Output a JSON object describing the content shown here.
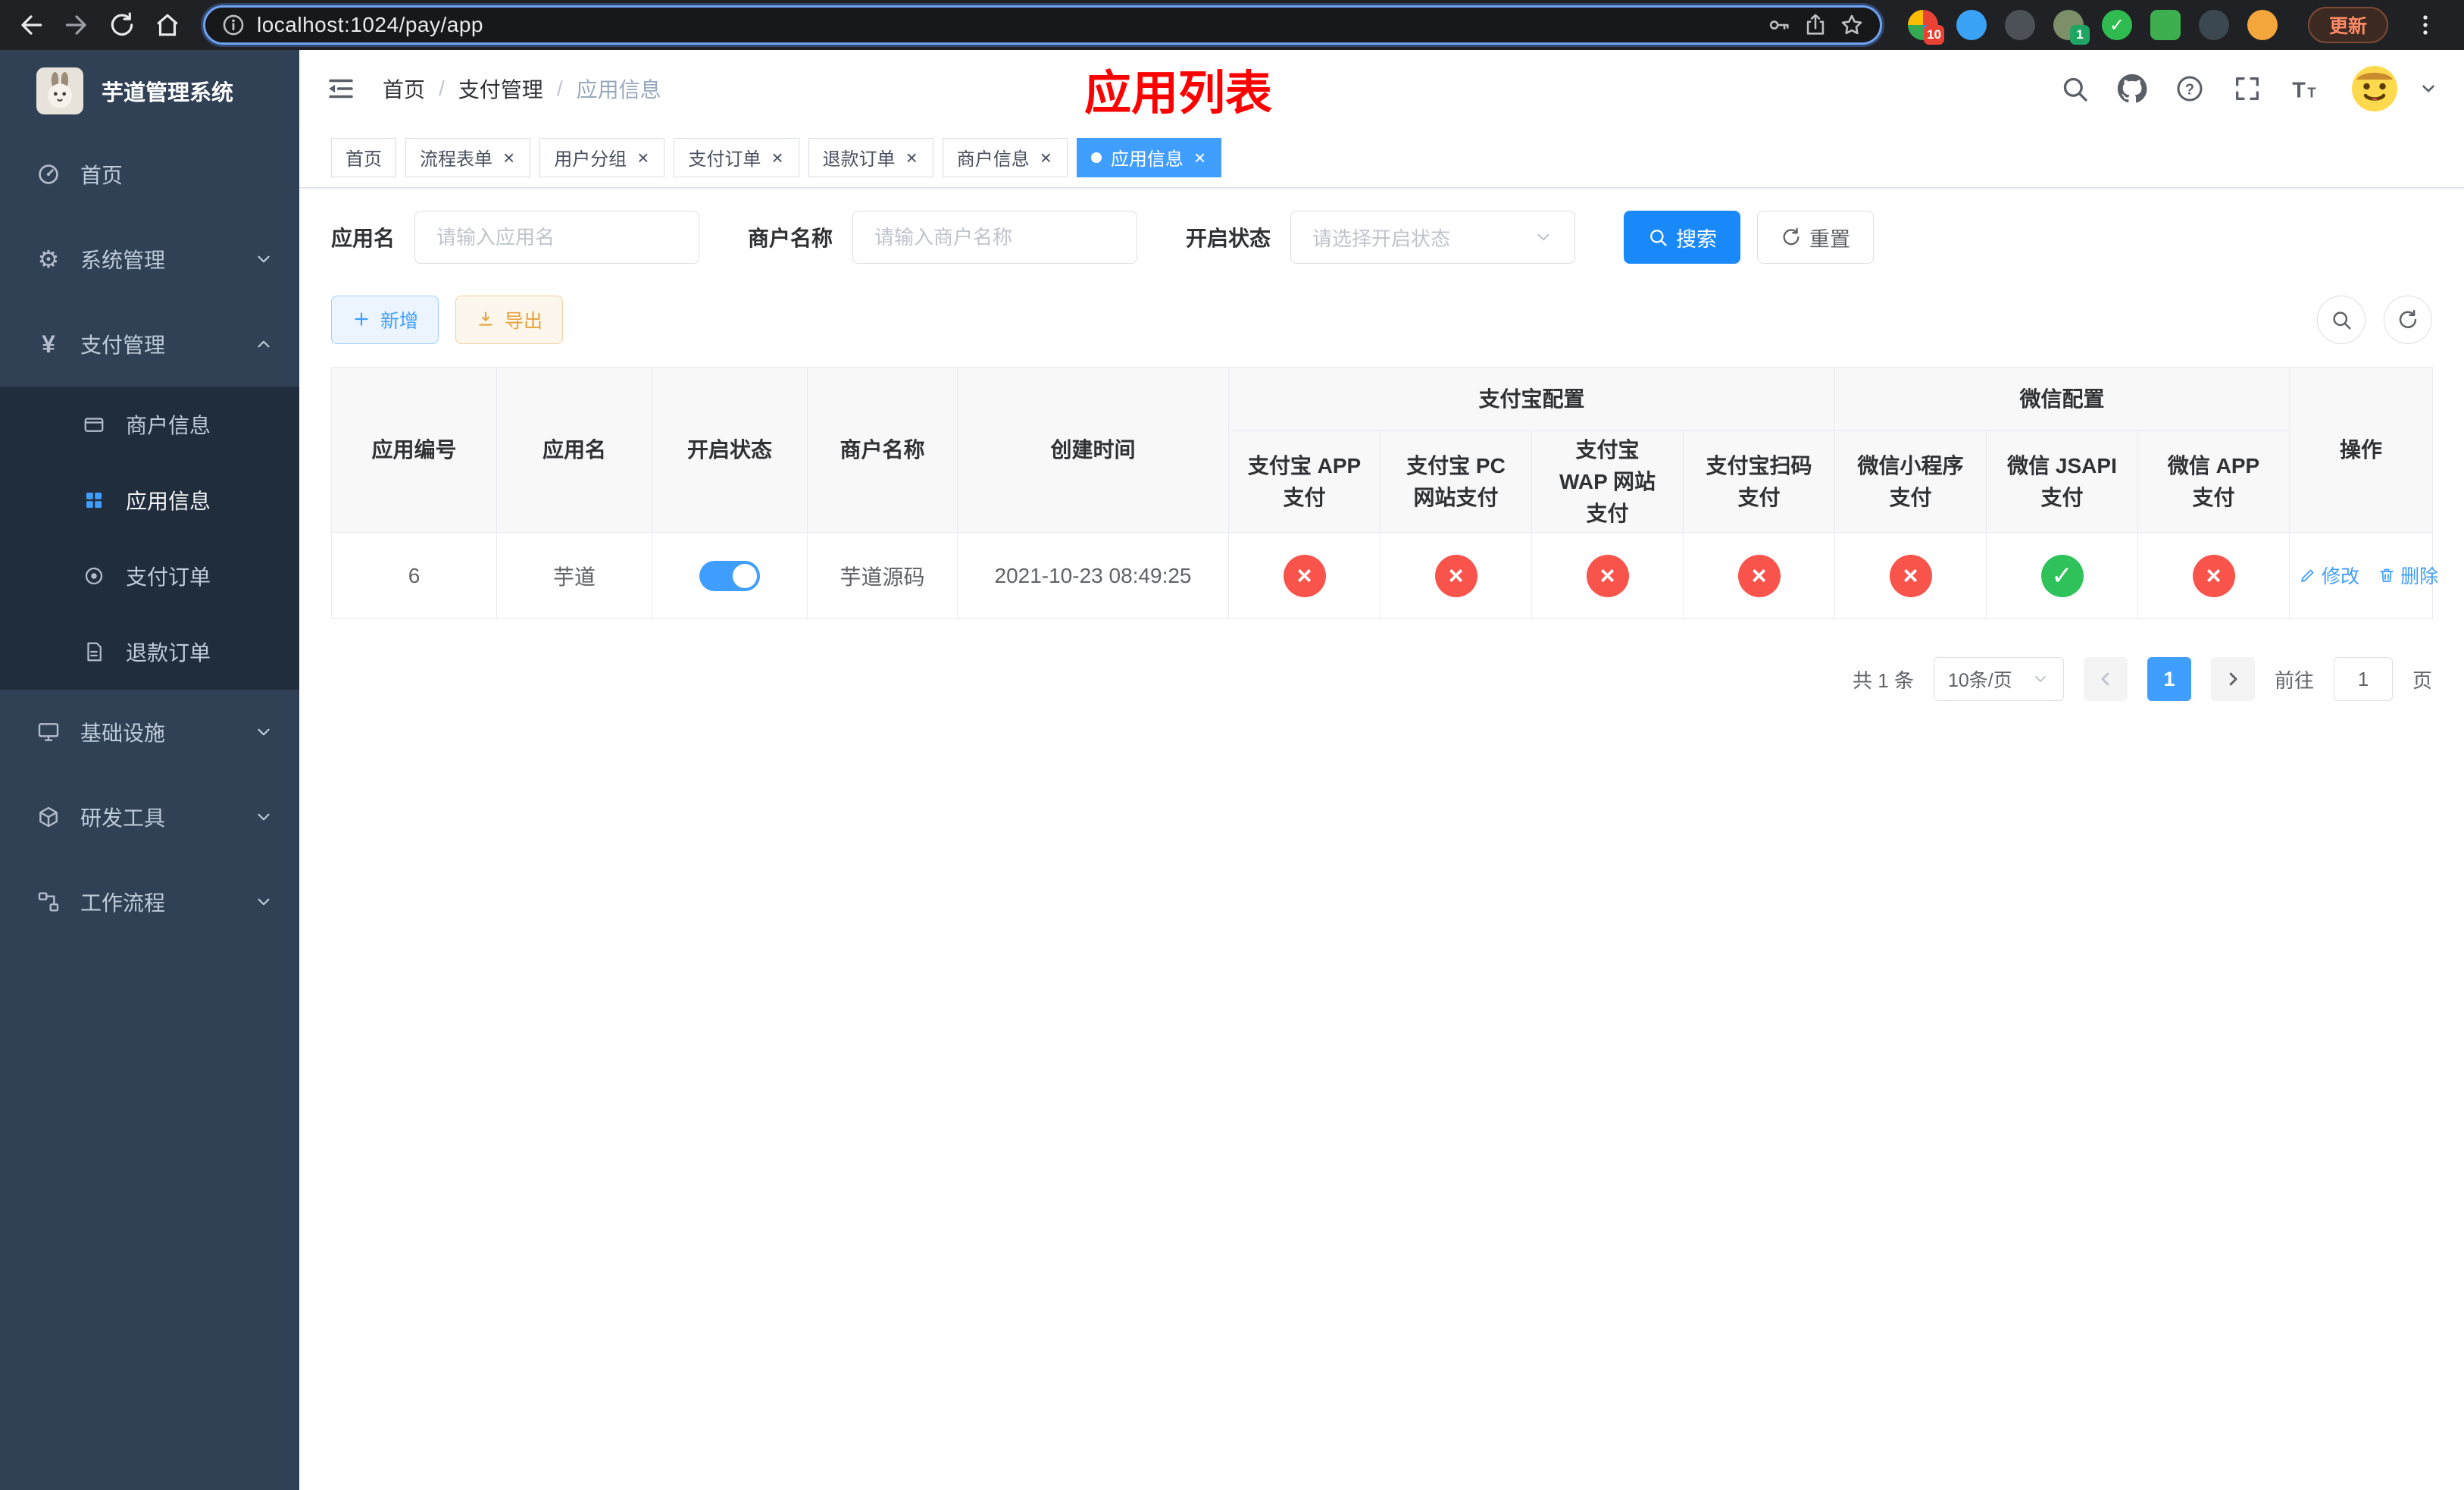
{
  "browser": {
    "url": "localhost:1024/pay/app",
    "update_label": "更新",
    "extensions": [
      {
        "name": "extension-icon-mosaic",
        "color": "multi",
        "shape": "circle",
        "badge": "10",
        "badge_color": "#e94235"
      },
      {
        "name": "extension-icon-drop",
        "color": "#3aa3f5",
        "shape": "circle"
      },
      {
        "name": "extension-icon-globe",
        "color": "#4b5156",
        "shape": "circle"
      },
      {
        "name": "extension-icon-avatar",
        "color": "#7d8f69",
        "shape": "circle",
        "badge": "1",
        "badge_color": "#1fa463"
      },
      {
        "name": "extension-icon-check",
        "color": "#2fbb4f",
        "shape": "circle",
        "glyph": "✓"
      },
      {
        "name": "extension-icon-notes",
        "color": "#3eaf4e",
        "shape": "square"
      },
      {
        "name": "extension-icon-pinwheel",
        "color": "#3b4852",
        "shape": "circle"
      },
      {
        "name": "extension-icon-face",
        "color": "#f3a63b",
        "shape": "circle"
      }
    ]
  },
  "sidebar": {
    "title": "芋道管理系统",
    "items": [
      {
        "label": "首页",
        "icon": "dashboard-icon",
        "type": "item"
      },
      {
        "label": "系统管理",
        "icon": "gear-icon",
        "type": "group",
        "expanded": false
      },
      {
        "label": "支付管理",
        "icon": "yen-icon",
        "type": "group",
        "expanded": true,
        "children": [
          {
            "label": "商户信息",
            "icon": "merchant-card-icon",
            "active": false
          },
          {
            "label": "应用信息",
            "icon": "app-grid-icon",
            "active": true
          },
          {
            "label": "支付订单",
            "icon": "pay-order-icon",
            "active": false
          },
          {
            "label": "退款订单",
            "icon": "refund-doc-icon",
            "active": false
          }
        ]
      },
      {
        "label": "基础设施",
        "icon": "infrastructure-icon",
        "type": "group",
        "expanded": false
      },
      {
        "label": "研发工具",
        "icon": "dev-tools-icon",
        "type": "group",
        "expanded": false
      },
      {
        "label": "工作流程",
        "icon": "workflow-icon",
        "type": "group",
        "expanded": false
      }
    ]
  },
  "header": {
    "breadcrumb": [
      "首页",
      "支付管理",
      "应用信息"
    ],
    "separator": "/",
    "overlay_title": "应用列表"
  },
  "tabs": [
    {
      "label": "首页",
      "closable": false,
      "active": false
    },
    {
      "label": "流程表单",
      "closable": true,
      "active": false
    },
    {
      "label": "用户分组",
      "closable": true,
      "active": false
    },
    {
      "label": "支付订单",
      "closable": true,
      "active": false
    },
    {
      "label": "退款订单",
      "closable": true,
      "active": false
    },
    {
      "label": "商户信息",
      "closable": true,
      "active": false
    },
    {
      "label": "应用信息",
      "closable": true,
      "active": true
    }
  ],
  "filters": {
    "app_name": {
      "label": "应用名",
      "placeholder": "请输入应用名",
      "value": ""
    },
    "merchant_name": {
      "label": "商户名称",
      "placeholder": "请输入商户名称",
      "value": ""
    },
    "status": {
      "label": "开启状态",
      "placeholder": "请选择开启状态",
      "value": ""
    },
    "search_label": "搜索",
    "reset_label": "重置"
  },
  "toolbar": {
    "add_label": "新增",
    "export_label": "导出"
  },
  "table": {
    "columns_simple": [
      "应用编号",
      "应用名",
      "开启状态",
      "商户名称",
      "创建时间"
    ],
    "group_alipay": "支付宝配置",
    "group_wechat": "微信配置",
    "alipay_columns": [
      "支付宝 APP 支付",
      "支付宝 PC 网站支付",
      "支付宝 WAP 网站支付",
      "支付宝扫码支付"
    ],
    "wechat_columns": [
      "微信小程序支付",
      "微信 JSAPI 支付",
      "微信 APP 支付"
    ],
    "col_actions": "操作",
    "rows": [
      {
        "app_id": "6",
        "app_name": "芋道",
        "status_on": true,
        "merchant_name": "芋道源码",
        "created_at": "2021-10-23 08:49:25",
        "pay_configs": [
          false,
          false,
          false,
          false,
          false,
          true,
          false
        ],
        "actions": [
          "修改",
          "删除"
        ]
      }
    ]
  },
  "pagination": {
    "total": "共 1 条",
    "page_size": "10条/页",
    "current_page": "1",
    "goto_label": "前往",
    "goto_value": "1",
    "page_unit": "页"
  },
  "colors": {
    "primary": "#409eff",
    "active_tab": "#409eff",
    "search_button": "#1989fa",
    "warning": "#e6a23c",
    "status_no": "#f9544b",
    "status_yes": "#2fc25b",
    "overlay_title": "#ff0000",
    "sidebar_bg": "#304156",
    "submenu_bg": "#1f2d3d"
  }
}
